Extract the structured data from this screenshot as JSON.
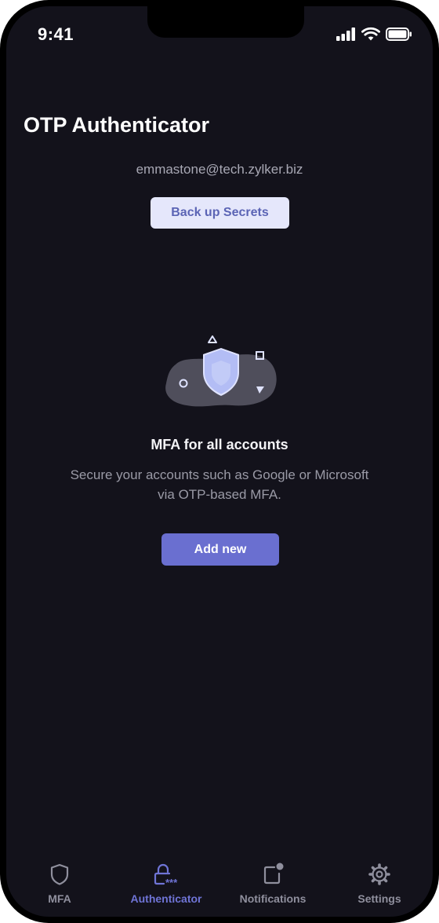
{
  "status_bar": {
    "time": "9:41"
  },
  "header": {
    "title": "OTP Authenticator"
  },
  "account": {
    "email": "emmastone@tech.zylker.biz"
  },
  "backup_button": {
    "label": "Back up Secrets"
  },
  "empty_state": {
    "heading": "MFA for all accounts",
    "description_line1": "Secure your accounts such as Google or Microsoft",
    "description_line2": "via OTP-based MFA.",
    "add_button_label": "Add new"
  },
  "tabs": [
    {
      "label": "MFA",
      "icon": "shield-icon"
    },
    {
      "label": "Authenticator",
      "icon": "lock-asterisk-icon",
      "active": true
    },
    {
      "label": "Notifications",
      "icon": "notification-icon"
    },
    {
      "label": "Settings",
      "icon": "gear-icon"
    }
  ],
  "colors": {
    "background": "#13121b",
    "accent": "#6a6fd0",
    "backup_button_bg": "#e5e7fb"
  }
}
